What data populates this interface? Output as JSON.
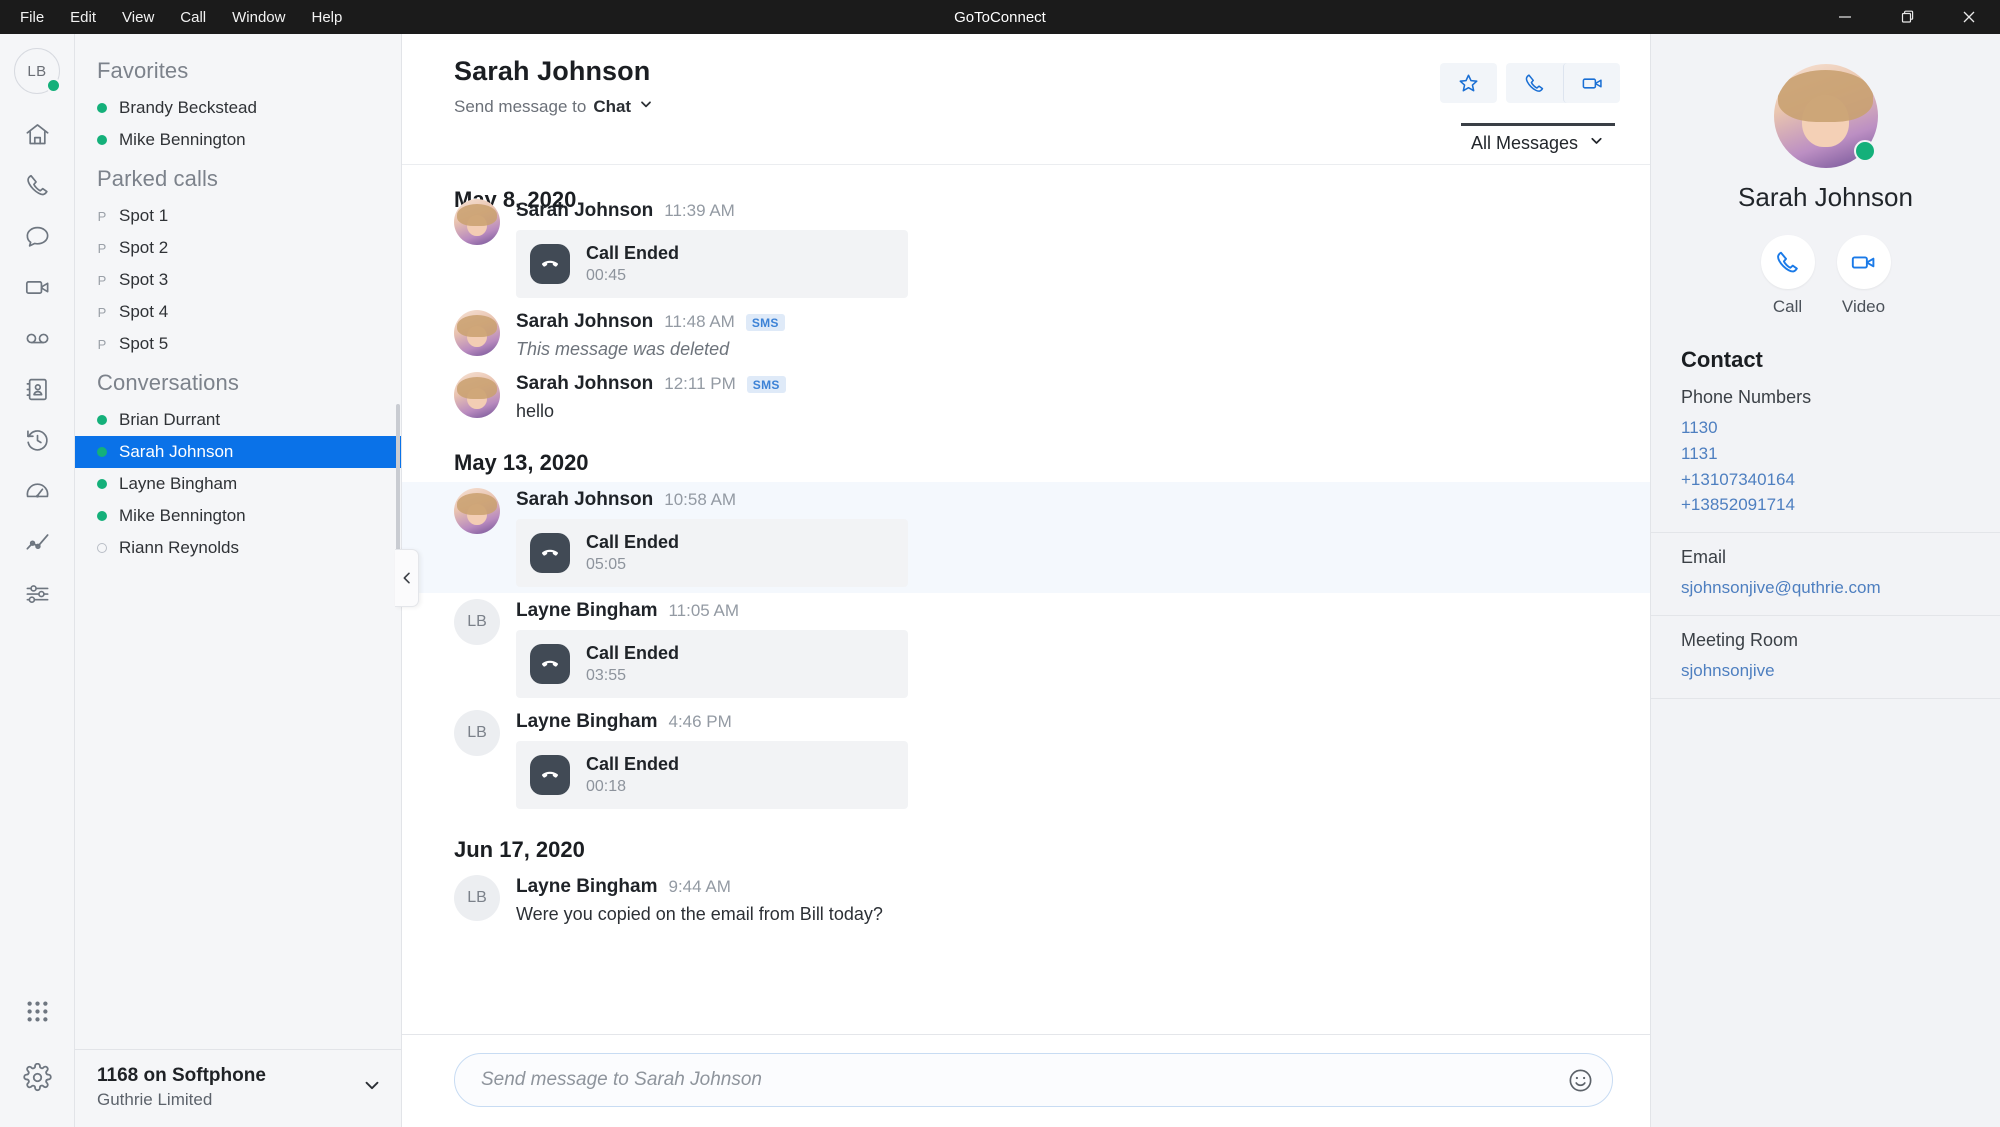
{
  "titlebar": {
    "menu": [
      "File",
      "Edit",
      "View",
      "Call",
      "Window",
      "Help"
    ],
    "app_title": "GoToConnect",
    "minimize_label": "—",
    "maximize_label": "❐",
    "close_label": "✕"
  },
  "rail": {
    "avatar_initials": "LB",
    "icons": [
      {
        "name": "home-icon"
      },
      {
        "name": "phone-icon"
      },
      {
        "name": "chat-icon"
      },
      {
        "name": "video-icon"
      },
      {
        "name": "voicemail-icon"
      },
      {
        "name": "contacts-icon"
      },
      {
        "name": "history-icon"
      },
      {
        "name": "dashboard-icon"
      },
      {
        "name": "analytics-icon"
      },
      {
        "name": "sliders-icon"
      }
    ],
    "bottom_icons": [
      {
        "name": "dialpad-icon"
      },
      {
        "name": "settings-gear-icon"
      }
    ]
  },
  "left_panel": {
    "sections": [
      {
        "title": "Favorites",
        "items": [
          {
            "label": "Brandy Beckstead",
            "status": "online"
          },
          {
            "label": "Mike Bennington",
            "status": "online"
          }
        ]
      },
      {
        "title": "Parked calls",
        "items": [
          {
            "label": "Spot 1",
            "marker": "P"
          },
          {
            "label": "Spot 2",
            "marker": "P"
          },
          {
            "label": "Spot 3",
            "marker": "P"
          },
          {
            "label": "Spot 4",
            "marker": "P"
          },
          {
            "label": "Spot 5",
            "marker": "P"
          }
        ]
      },
      {
        "title": "Conversations",
        "items": [
          {
            "label": "Brian Durrant",
            "status": "online"
          },
          {
            "label": "Sarah Johnson",
            "status": "online",
            "selected": true
          },
          {
            "label": "Layne Bingham",
            "status": "online"
          },
          {
            "label": "Mike Bennington",
            "status": "online"
          },
          {
            "label": "Riann Reynolds",
            "status": "offline"
          }
        ]
      }
    ],
    "footer": {
      "line1": "1168 on Softphone",
      "line2": "Guthrie Limited"
    }
  },
  "chat": {
    "title": "Sarah Johnson",
    "send_to_label": "Send message to",
    "send_to_value": "Chat",
    "filter_label": "All Messages",
    "header_buttons": [
      {
        "name": "favorite-star-button"
      },
      {
        "name": "call-button"
      },
      {
        "name": "video-button"
      }
    ],
    "groups": [
      {
        "date": "May 8, 2020",
        "messages": [
          {
            "author": "Sarah Johnson",
            "time": "11:39 AM",
            "avatar_type": "photo",
            "clipped": true,
            "call": {
              "title": "Call Ended",
              "duration": "00:45"
            }
          },
          {
            "author": "Sarah Johnson",
            "time": "11:48 AM",
            "badge": "SMS",
            "avatar_type": "photo",
            "text": "This message was deleted",
            "deleted": true
          },
          {
            "author": "Sarah Johnson",
            "time": "12:11 PM",
            "badge": "SMS",
            "avatar_type": "photo",
            "text": "hello"
          }
        ]
      },
      {
        "date": "May 13, 2020",
        "messages": [
          {
            "author": "Sarah Johnson",
            "time": "10:58 AM",
            "avatar_type": "photo",
            "highlight": true,
            "call": {
              "title": "Call Ended",
              "duration": "05:05"
            }
          },
          {
            "author": "Layne Bingham",
            "time": "11:05 AM",
            "avatar_type": "initials",
            "initials": "LB",
            "call": {
              "title": "Call Ended",
              "duration": "03:55"
            }
          },
          {
            "author": "Layne Bingham",
            "time": "4:46 PM",
            "avatar_type": "initials",
            "initials": "LB",
            "call": {
              "title": "Call Ended",
              "duration": "00:18"
            }
          }
        ]
      },
      {
        "date": "Jun 17, 2020",
        "messages": [
          {
            "author": "Layne Bingham",
            "time": "9:44 AM",
            "avatar_type": "initials",
            "initials": "LB",
            "text": "Were you copied on the email from Bill today?"
          }
        ]
      }
    ],
    "composer": {
      "placeholder": "Send message to Sarah Johnson",
      "value": ""
    }
  },
  "contact_panel": {
    "name": "Sarah Johnson",
    "actions": [
      {
        "label": "Call",
        "name": "contact-call-button"
      },
      {
        "label": "Video",
        "name": "contact-video-button"
      }
    ],
    "section_title": "Contact",
    "phone_label": "Phone Numbers",
    "phones": [
      "1130",
      "1131",
      "+13107340164",
      "+13852091714"
    ],
    "email_label": "Email",
    "email": "sjohnsonjive@quthrie.com",
    "meeting_room_label": "Meeting Room",
    "meeting_room": "sjohnsonjive"
  },
  "colors": {
    "accent_blue": "#0a72e8",
    "link_blue": "#4e7fc0",
    "presence_green": "#14b07a",
    "titlebar_bg": "#1b1b1b"
  }
}
